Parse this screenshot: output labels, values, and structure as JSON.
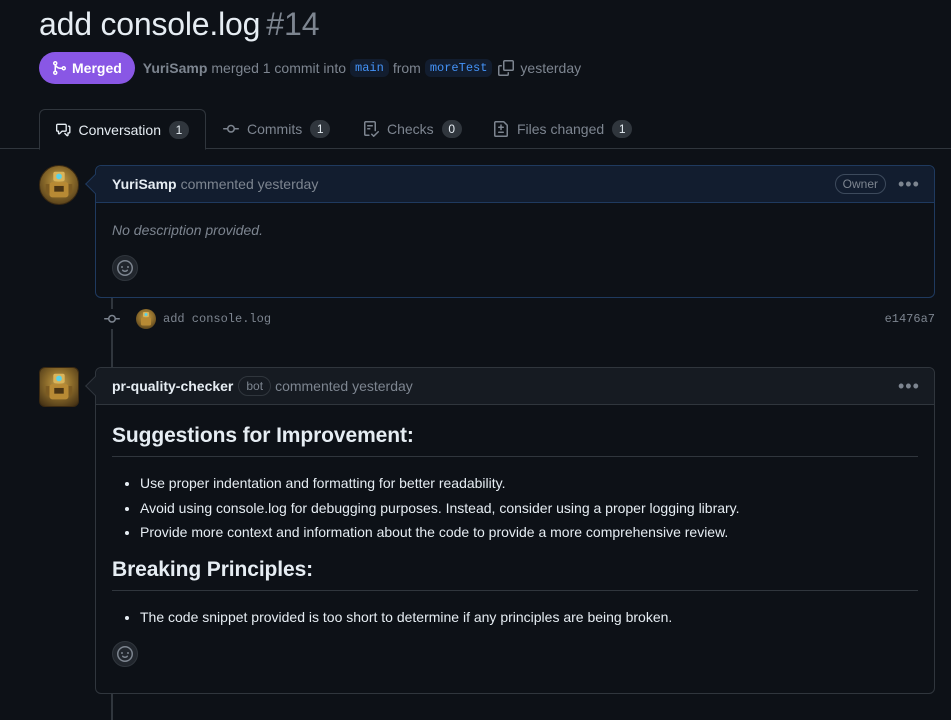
{
  "header": {
    "title": "add console.log",
    "number": "#14",
    "state": "Merged",
    "author": "YuriSamp",
    "summary": "merged 1 commit into",
    "base_branch": "main",
    "from_word": "from",
    "head_branch": "moreTest",
    "time": "yesterday"
  },
  "tabs": [
    {
      "label": "Conversation",
      "count": "1"
    },
    {
      "label": "Commits",
      "count": "1"
    },
    {
      "label": "Checks",
      "count": "0"
    },
    {
      "label": "Files changed",
      "count": "1"
    }
  ],
  "comment1": {
    "author": "YuriSamp",
    "action": "commented yesterday",
    "role": "Owner",
    "body": "No description provided."
  },
  "commit": {
    "message": "add console.log",
    "sha": "e1476a7"
  },
  "comment2": {
    "author": "pr-quality-checker",
    "badge": "bot",
    "action": "commented yesterday",
    "heading1": "Suggestions for Improvement:",
    "items1": [
      "Use proper indentation and formatting for better readability.",
      "Avoid using console.log for debugging purposes. Instead, consider using a proper logging library.",
      "Provide more context and information about the code to provide a more comprehensive review."
    ],
    "heading2": "Breaking Principles:",
    "items2": [
      "The code snippet provided is too short to determine if any principles are being broken."
    ]
  },
  "colors": {
    "background": "#0d1117",
    "merged": "#8957e5",
    "branch_text": "#4493f8",
    "muted": "#7d8590"
  }
}
